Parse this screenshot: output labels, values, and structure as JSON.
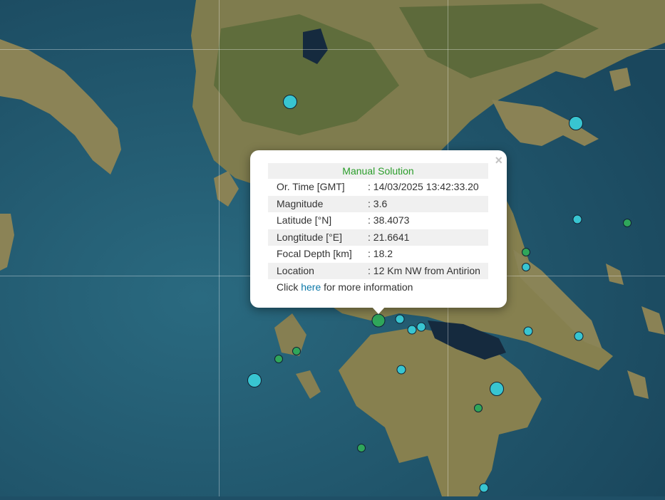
{
  "map": {
    "colors": {
      "sea_deep": "#1f4f66",
      "sea_shallow": "#2f6f84",
      "land": "#8a8255",
      "land_green": "#5f6d3c",
      "lake": "#152a3e"
    }
  },
  "markers": {
    "teal_color": "#38c5d1",
    "green_color": "#2fa65a"
  },
  "popup": {
    "title": "Manual Solution",
    "close_label": "×",
    "rows": [
      {
        "label": "Or. Time [GMT]",
        "value": ": 14/03/2025 13:42:33.20"
      },
      {
        "label": "Magnitude",
        "value": ": 3.6"
      },
      {
        "label": "Latitude [°N]",
        "value": ": 38.4073"
      },
      {
        "label": "Longtitude [°E]",
        "value": ": 21.6641"
      },
      {
        "label": "Focal Depth [km]",
        "value": ": 18.2"
      },
      {
        "label": "Location",
        "value": ": 12 Km NW from Antirion"
      }
    ],
    "more_prefix": "Click ",
    "more_link": "here",
    "more_suffix": " for more information"
  }
}
